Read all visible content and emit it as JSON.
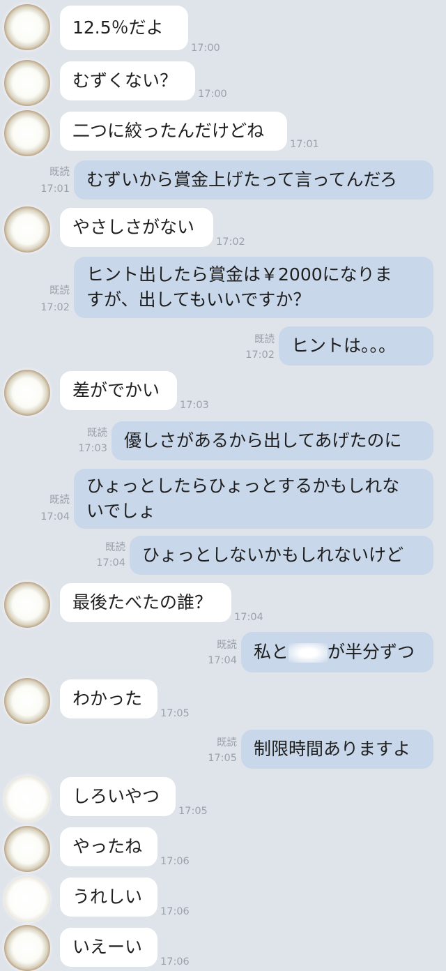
{
  "messages": [
    {
      "side": "in",
      "text": "12.5％だよ",
      "time": "17:00"
    },
    {
      "side": "in",
      "text": "むずくない？",
      "time": "17:00"
    },
    {
      "side": "in",
      "text": "二つに絞ったんだけどね",
      "time": "17:01"
    },
    {
      "side": "out",
      "text": "むずいから賞金上げたって言ってんだろ",
      "read": "既読",
      "time": "17:01"
    },
    {
      "side": "in",
      "text": "やさしさがない",
      "time": "17:02"
    },
    {
      "side": "out",
      "line1": "ヒント出したら賞金は￥2000になりま",
      "line2": "すが、出してもいいですか？",
      "read": "既読",
      "time": "17:02"
    },
    {
      "side": "out",
      "text": "ヒントは。。。",
      "read": "既読",
      "time": "17:02"
    },
    {
      "side": "in",
      "text": "差がでかい",
      "time": "17:03"
    },
    {
      "side": "out",
      "text": "優しさがあるから出してあげたのに",
      "read": "既読",
      "time": "17:03"
    },
    {
      "side": "out",
      "line1": "ひょっとしたらひょっとするかもしれな",
      "line2": "いでしょ",
      "read": "既読",
      "time": "17:04"
    },
    {
      "side": "out",
      "text": "ひょっとしないかもしれないけど",
      "read": "既読",
      "time": "17:04"
    },
    {
      "side": "in",
      "text": "最後たべたの誰？",
      "time": "17:04"
    },
    {
      "side": "out",
      "pre": "私と",
      "post": "が半分ずつ",
      "read": "既読",
      "time": "17:04"
    },
    {
      "side": "in",
      "text": "わかった",
      "time": "17:05"
    },
    {
      "side": "out",
      "text": "制限時間ありますよ",
      "read": "既読",
      "time": "17:05"
    },
    {
      "side": "in",
      "text": "しろいやつ",
      "time": "17:05"
    },
    {
      "side": "in",
      "text": "やったね",
      "time": "17:06"
    },
    {
      "side": "in",
      "text": "うれしい",
      "time": "17:06"
    },
    {
      "side": "in",
      "text": "いえーい",
      "time": "17:06"
    }
  ]
}
